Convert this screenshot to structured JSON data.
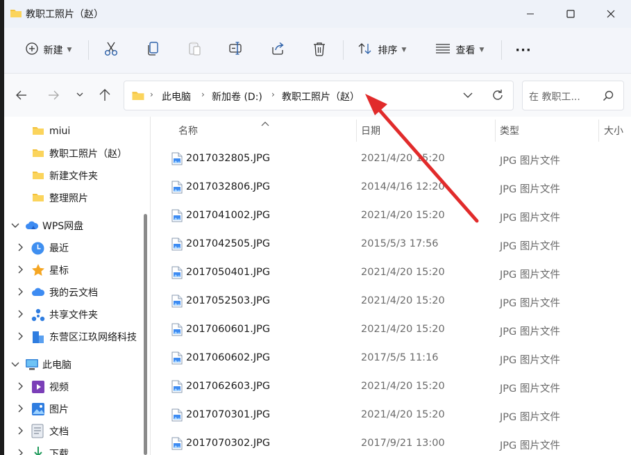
{
  "window": {
    "title": "教职工照片（赵）"
  },
  "toolbar": {
    "new_label": "新建",
    "sort_label": "排序",
    "view_label": "查看",
    "more_label": "···"
  },
  "address": {
    "crumbs": [
      "此电脑",
      "新加卷 (D:)",
      "教职工照片（赵）"
    ],
    "search_placeholder": "在 教职工..."
  },
  "nav": {
    "items": [
      {
        "label": "miui",
        "icon": "folder-icon"
      },
      {
        "label": "教职工照片（赵）",
        "icon": "folder-icon"
      },
      {
        "label": "新建文件夹",
        "icon": "folder-icon"
      },
      {
        "label": "整理照片",
        "icon": "folder-icon"
      },
      {
        "label": "WPS网盘",
        "icon": "cloud-icon"
      },
      {
        "label": "最近",
        "icon": "clock-icon"
      },
      {
        "label": "星标",
        "icon": "star-icon"
      },
      {
        "label": "我的云文档",
        "icon": "cloud-doc-icon"
      },
      {
        "label": "共享文件夹",
        "icon": "share-icon"
      },
      {
        "label": "东营区江玖网络科技",
        "icon": "building-icon"
      },
      {
        "label": "此电脑",
        "icon": "monitor-icon"
      },
      {
        "label": "视频",
        "icon": "video-icon"
      },
      {
        "label": "图片",
        "icon": "picture-icon"
      },
      {
        "label": "文档",
        "icon": "document-icon"
      },
      {
        "label": "下载",
        "icon": "download-icon"
      }
    ]
  },
  "columns": {
    "name": "名称",
    "date": "日期",
    "type": "类型",
    "size": "大小"
  },
  "files": [
    {
      "name": "2017032805.JPG",
      "date": "2021/4/20 15:20",
      "type": "JPG 图片文件"
    },
    {
      "name": "2017032806.JPG",
      "date": "2014/4/16 12:20",
      "type": "JPG 图片文件"
    },
    {
      "name": "2017041002.JPG",
      "date": "2021/4/20 15:20",
      "type": "JPG 图片文件"
    },
    {
      "name": "2017042505.JPG",
      "date": "2015/5/3 17:56",
      "type": "JPG 图片文件"
    },
    {
      "name": "2017050401.JPG",
      "date": "2021/4/20 15:20",
      "type": "JPG 图片文件"
    },
    {
      "name": "2017052503.JPG",
      "date": "2021/4/20 15:20",
      "type": "JPG 图片文件"
    },
    {
      "name": "2017060601.JPG",
      "date": "2021/4/20 15:20",
      "type": "JPG 图片文件"
    },
    {
      "name": "2017060602.JPG",
      "date": "2017/5/5 11:16",
      "type": "JPG 图片文件"
    },
    {
      "name": "2017062603.JPG",
      "date": "2021/4/20 15:20",
      "type": "JPG 图片文件"
    },
    {
      "name": "2017070301.JPG",
      "date": "2021/4/20 15:20",
      "type": "JPG 图片文件"
    },
    {
      "name": "2017070302.JPG",
      "date": "2017/9/21 13:00",
      "type": "JPG 图片文件"
    }
  ],
  "colors": {
    "folder": "#f3c13a",
    "accent_arrow": "#e12b2b"
  }
}
